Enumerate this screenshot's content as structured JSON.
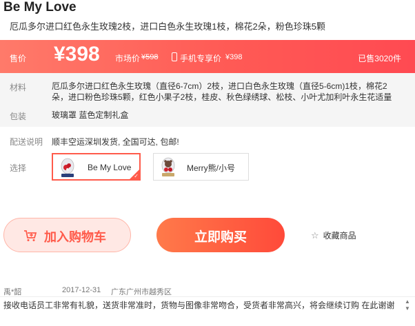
{
  "product": {
    "title": "Be My Love",
    "subtitle": "厄瓜多尔进口红色永生玫瑰2枝，进口白色永生玫瑰1枝，棉花2朵，粉色珍珠5颗"
  },
  "price": {
    "label": "售价",
    "value": "¥398",
    "market_label": "市场价",
    "market_value": "¥598",
    "mobile_label": "手机专享价",
    "mobile_value": "¥398",
    "sold": "已售3020件"
  },
  "details": {
    "material_label": "材料",
    "material_value": "厄瓜多尔进口红色永生玫瑰（直径6-7cm）2枝，进口白色永生玫瑰（直径5-6cm)1枝，棉花2朵，进口粉色珍珠5颗，红色小果子2枝，桂皮、秋色绿绣球、松枝、小叶尤加利叶永生花适量",
    "package_label": "包装",
    "package_value": "玻璃罩 蓝色定制礼盒",
    "delivery_label": "配送说明",
    "delivery_value": "顺丰空运深圳发货, 全国可达, 包邮!",
    "choose_label": "选择"
  },
  "options": [
    {
      "label": "Be My Love",
      "selected": true
    },
    {
      "label": "Merry熊/小号",
      "selected": false
    }
  ],
  "actions": {
    "cart": "加入购物车",
    "buy": "立即购买",
    "favorite": "收藏商品"
  },
  "review": {
    "user": "禹*韶",
    "date": "2017-12-31",
    "location": "广东广州市越秀区",
    "text": "接收电话员工非常有礼貌，送货非常准时，货物与图像非常吻合，受货者非常高兴，将会继续订购 在此谢谢"
  },
  "colors": {
    "accent": "#ff5a4a",
    "price_bar": "#ff5a55"
  }
}
